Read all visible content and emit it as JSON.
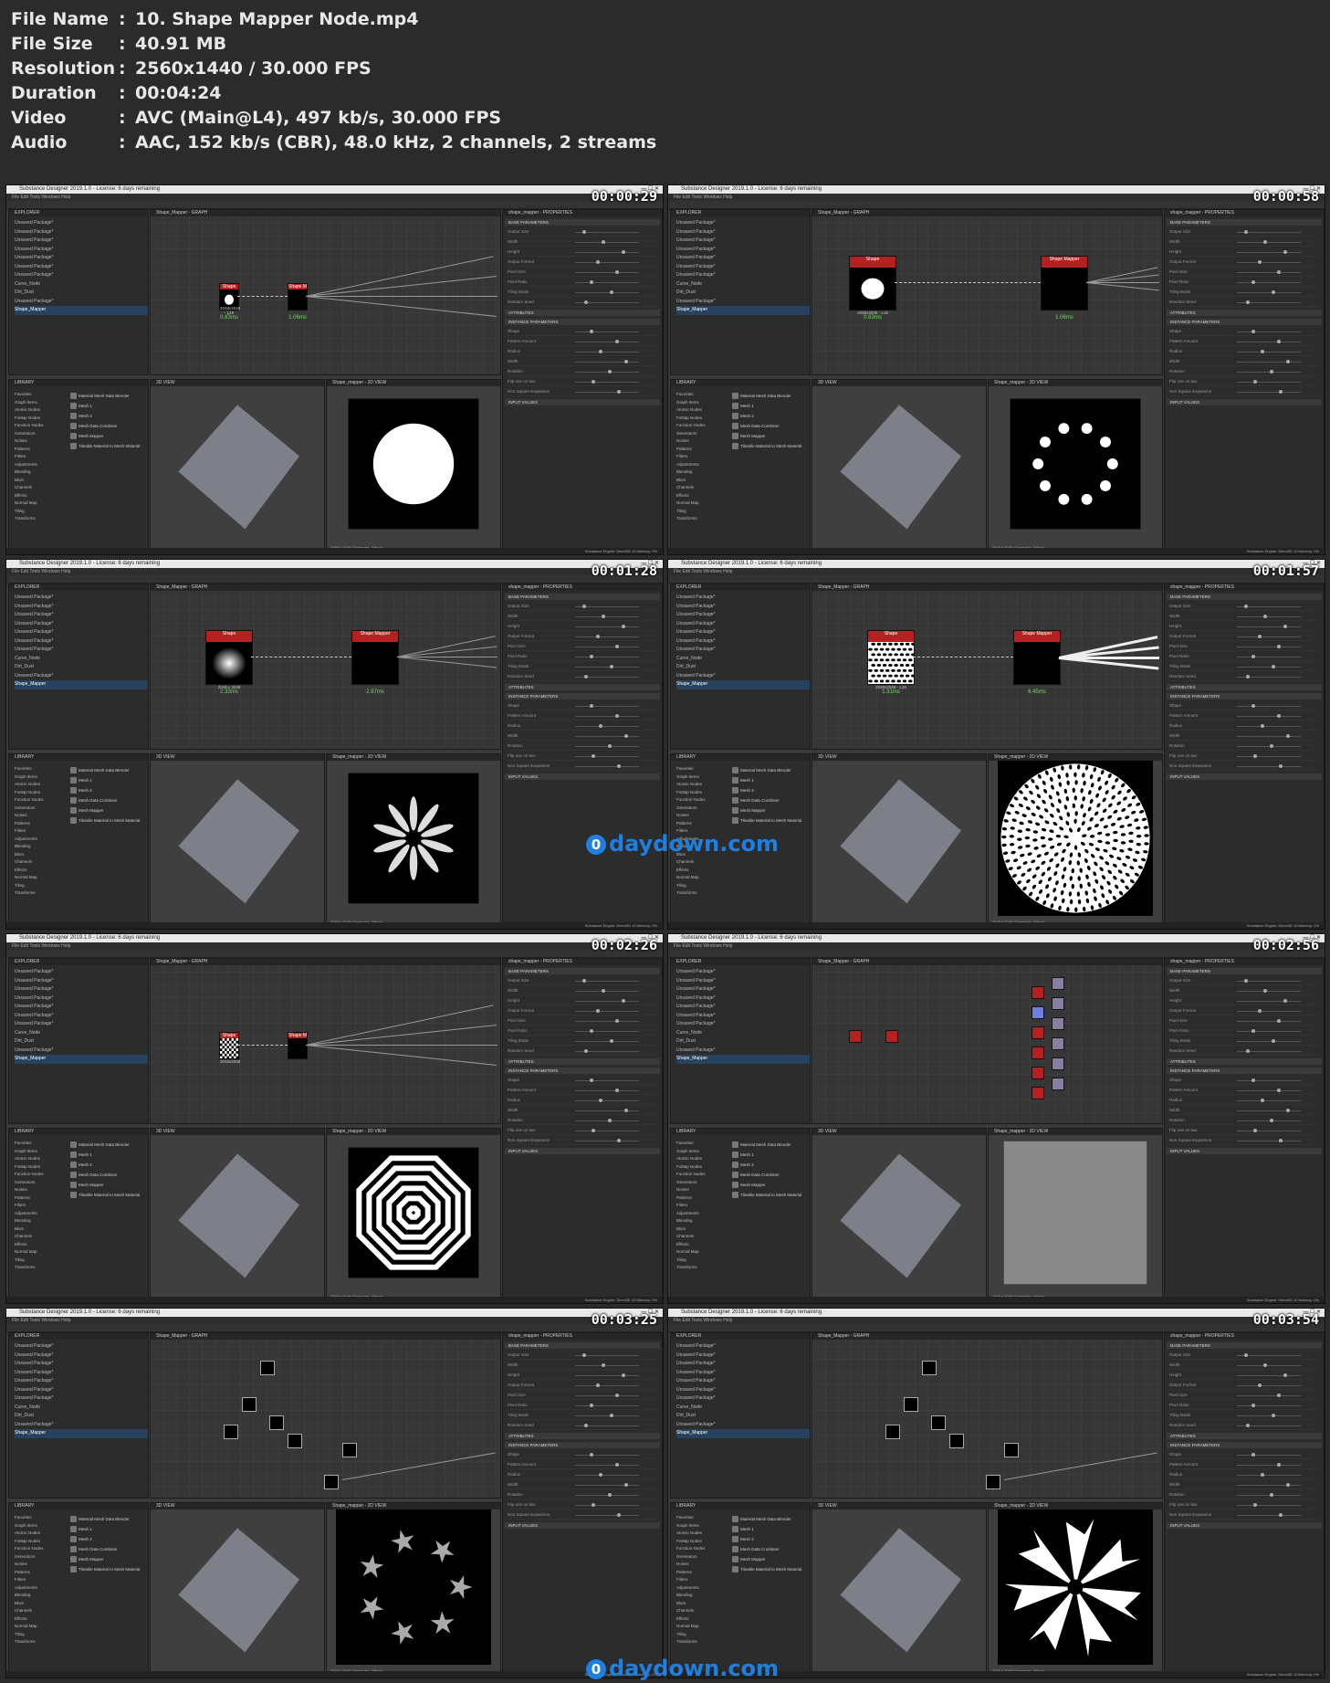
{
  "info": [
    {
      "key": "File Name",
      "value": "10. Shape Mapper Node.mp4"
    },
    {
      "key": "File Size",
      "value": "40.91 MB"
    },
    {
      "key": "Resolution",
      "value": "2560x1440 / 30.000 FPS"
    },
    {
      "key": "Duration",
      "value": "00:04:24"
    },
    {
      "key": "Video",
      "value": "AVC (Main@L4), 497 kb/s, 30.000 FPS"
    },
    {
      "key": "Audio",
      "value": "AAC, 152 kb/s (CBR), 48.0 kHz, 2 channels, 2 streams"
    }
  ],
  "separator": ":",
  "app_title": "Substance Designer 2019.1.0 - License: 6 days remaining",
  "menu": "File   Edit   Tools   Windows   Help",
  "panels": {
    "explorer": "EXPLORER",
    "library": "LIBRARY",
    "graph": "Shape_Mapper - GRAPH",
    "view3d": "3D VIEW",
    "view2d": "Shape_mapper - 2D VIEW",
    "properties": "shape_mapper - PROPERTIES"
  },
  "explorer_items": [
    "Unsaved Package*",
    "Unsaved Package*",
    "Unsaved Package*",
    "Unsaved Package*",
    "Unsaved Package*",
    "Unsaved Package*",
    "Unsaved Package*",
    "Curve_Node",
    "Dirt_Dust",
    "Unsaved Package*",
    "Shape_Mapper"
  ],
  "library_categories": [
    "Favorites",
    "Graph Items",
    "Atomic Nodes",
    "FxMap Nodes",
    "Function Nodes",
    "Generators",
    "Noises",
    "Patterns",
    "Filters",
    "Adjustments",
    "Blending",
    "Blurs",
    "Channels",
    "Effects",
    "Normal Map",
    "Tiling",
    "Transforms"
  ],
  "library_items": [
    "Material Mesh Data Blender",
    "Mesh 1",
    "Mesh 2",
    "Mesh Data Combiner",
    "Mesh Mapper",
    "Tileable Material to Mesh Material"
  ],
  "properties_sections": [
    "BASE PARAMETERS",
    "ATTRIBUTES",
    "INSTANCE PARAMETERS",
    "INPUT VALUES"
  ],
  "property_rows": [
    "Output Size",
    "Width",
    "Height",
    "Output Format",
    "Pixel Size",
    "Pixel Ratio",
    "Tiling Mode",
    "Random Seed"
  ],
  "instance_rows": [
    "Shape",
    "Pattern Amount",
    "Radius",
    "Width",
    "Rotation",
    "Flip one on two",
    "Non Square Expansion"
  ],
  "frames": [
    {
      "timestamp": "00:00:29",
      "node_a": "Shape",
      "node_b": "Shape Mapper",
      "time_a": "0.83ms",
      "time_b": "1.06ms",
      "res": "2048x2048 - L16",
      "shape": "circle",
      "view": "disc"
    },
    {
      "timestamp": "00:00:58",
      "node_a": "Shape",
      "node_b": "Shape Mapper",
      "time_a": "0.83ms",
      "time_b": "1.06ms",
      "res": "2048x2048 - L16",
      "shape": "circle",
      "view": "ring"
    },
    {
      "timestamp": "00:01:28",
      "node_a": "Shape",
      "node_b": "Shape Mapper",
      "time_a": "2.33ms",
      "time_b": "2.97ms",
      "res": "2048 x 2048",
      "shape": "glow",
      "view": "flower"
    },
    {
      "timestamp": "00:01:57",
      "node_a": "Shape",
      "node_b": "Shape Mapper",
      "time_a": "1.31ms",
      "time_b": "6.45ms",
      "res": "2048x2048 - L16",
      "shape": "dots",
      "view": "spiral"
    },
    {
      "timestamp": "00:02:26",
      "node_a": "Shape",
      "node_b": "Shape Mapper",
      "time_a": "",
      "time_b": "",
      "res": "2048x2048",
      "shape": "checker",
      "view": "octagon"
    },
    {
      "timestamp": "00:02:56",
      "node_a": "",
      "node_b": "",
      "time_a": "",
      "time_b": "",
      "res": "",
      "shape": "nodes",
      "view": "gray"
    },
    {
      "timestamp": "00:03:25",
      "node_a": "",
      "node_b": "",
      "time_a": "",
      "time_b": "",
      "res": "2048 x 2048 (Grayscale, 16bpc)",
      "shape": "graph",
      "view": "stars"
    },
    {
      "timestamp": "00:03:54",
      "node_a": "",
      "node_b": "",
      "time_a": "",
      "time_b": "",
      "res": "2048 x 2048 (Grayscale, 16bpc)",
      "shape": "graph",
      "view": "burst"
    }
  ],
  "watermark": "daydown.com",
  "watermark_badge": "0",
  "status": "Substance Engine: Direct3D 10   Memory: 0%",
  "view_res": "2048 x 2048 (Grayscale, 16bpc)",
  "colors": {
    "accent": "#b52020",
    "time_green": "#6fdc5b",
    "watermark": "#1e7fe0"
  }
}
